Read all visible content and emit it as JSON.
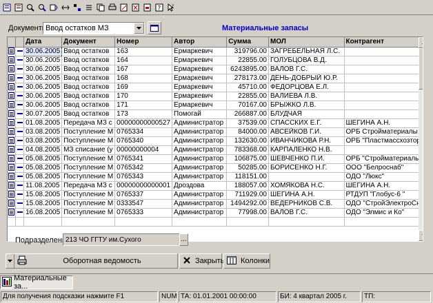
{
  "toolbar": {
    "icons": [
      "new-doc-icon",
      "list-icon",
      "find-icon",
      "find-next-icon",
      "sort-icon",
      "filter-icon",
      "split-icon",
      "columns-icon",
      "copy-icon",
      "print-icon",
      "edit-icon",
      "delete-icon",
      "export-icon",
      "help-icon",
      "pointer-help-icon"
    ]
  },
  "filter": {
    "documents_label": "Документы",
    "documents_value": "Ввод остатков МЗ"
  },
  "title": "Материальные запасы",
  "table": {
    "columns": [
      "",
      "",
      "Дата",
      "Документ",
      "Номер",
      "Автор",
      "Сумма",
      "МОЛ",
      "Контрагент"
    ],
    "rows": [
      {
        "date": "30.06.2005",
        "doc": "Ввод остатков",
        "num": "163",
        "author": "Ермаркевич",
        "sum": "319796.00",
        "mol": "ЗАГРЕБЕЛЬНАЯ Л.С.",
        "agent": ""
      },
      {
        "date": "30.06.2005",
        "doc": "Ввод остатков",
        "num": "164",
        "author": "Ермаркевич",
        "sum": "22855.00",
        "mol": "ГОЛУБЦОВА В.Д.",
        "agent": ""
      },
      {
        "date": "30.06.2005",
        "doc": "Ввод остатков",
        "num": "167",
        "author": "Ермаркевич",
        "sum": "6243895.00",
        "mol": "ВАЛОВ Г.С.",
        "agent": ""
      },
      {
        "date": "30.06.2005",
        "doc": "Ввод остатков",
        "num": "168",
        "author": "Ермаркевич",
        "sum": "278173.00",
        "mol": "ДЕНЬ-ДОБРЫЙ Ю.Р.",
        "agent": ""
      },
      {
        "date": "30.06.2005",
        "doc": "Ввод остатков",
        "num": "169",
        "author": "Ермаркевич",
        "sum": "45710.00",
        "mol": "ФЕДОРЦОВА Е.Л.",
        "agent": ""
      },
      {
        "date": "30.06.2005",
        "doc": "Ввод остатков",
        "num": "170",
        "author": "Ермаркевич",
        "sum": "22855.00",
        "mol": "ВАЛИЕВА Л.В.",
        "agent": ""
      },
      {
        "date": "30.06.2005",
        "doc": "Ввод остатков",
        "num": "171",
        "author": "Ермаркевич",
        "sum": "70167.00",
        "mol": "БРЫЖКО Л.В.",
        "agent": ""
      },
      {
        "date": "30.07.2005",
        "doc": "Ввод остатков",
        "num": "173",
        "author": "Помогай",
        "sum": "266887.00",
        "mol": "БЛУДЧАЯ",
        "agent": ""
      },
      {
        "date": "01.08.2005",
        "doc": "Передача МЗ с",
        "num": "00000000000527",
        "author": "Администратор",
        "sum": "37539.00",
        "mol": "СПАССКИХ Е.Г.",
        "agent": "ШЕГИНА А.Н."
      },
      {
        "date": "03.08.2005",
        "doc": "Поступление М",
        "num": "0765334",
        "author": "Администратор",
        "sum": "84000.00",
        "mol": "АВСЕЙКОВ Г.И.",
        "agent": "ОРБ Стройматериалы"
      },
      {
        "date": "03.08.2005",
        "doc": "Поступление М",
        "num": "0765340",
        "author": "Администратор",
        "sum": "132630.00",
        "mol": "ИВАНЧИКОВА Р.Н.",
        "agent": "ОРБ \"Пластмассхозтор"
      },
      {
        "date": "04.08.2005",
        "doc": "МЗ списание (у",
        "num": "00000000004",
        "author": "Администратор",
        "sum": "783368.00",
        "mol": "КАРПАЛЕНКО Н.В.",
        "agent": ""
      },
      {
        "date": "05.08.2005",
        "doc": "Поступление М",
        "num": "0765341",
        "author": "Администратор",
        "sum": "106875.00",
        "mol": "ШЕВЧЕНКО П.И.",
        "agent": "ОРБ \"Стройматериалы"
      },
      {
        "date": "05.08.2005",
        "doc": "Поступление М",
        "num": "0765342",
        "author": "Администратор",
        "sum": "50285.00",
        "mol": "БОРИСЕНКО Н.Г.",
        "agent": "ООО \"Белроснаб\""
      },
      {
        "date": "05.08.2005",
        "doc": "Поступление М",
        "num": "0765343",
        "author": "Администратор",
        "sum": "118151.00",
        "mol": "",
        "agent": "ОДО \"Люкс\""
      },
      {
        "date": "11.08.2005",
        "doc": "Передача МЗ с",
        "num": "00000000000001",
        "author": "Дроздова",
        "sum": "188057.00",
        "mol": "ХОМЯКОВА Н.С.",
        "agent": "ШЕГИНА А.Н."
      },
      {
        "date": "15.08.2005",
        "doc": "Поступление М",
        "num": "0765337",
        "author": "Администратор",
        "sum": "711929.00",
        "mol": "ШЕГИНА А.Н.",
        "agent": "РТДУП \"Глобус-6 \""
      },
      {
        "date": "15.08.2005",
        "doc": "Поступление М",
        "num": "0333547",
        "author": "Администратор",
        "sum": "1494292.00",
        "mol": "ВЕДЕРНИКОВ С.В.",
        "agent": "ОДО \"СтройЭлектроСн"
      },
      {
        "date": "16.08.2005",
        "doc": "Поступление М",
        "num": "0765333",
        "author": "Администратор",
        "sum": "77998.00",
        "mol": "ВАЛОВ Г.С.",
        "agent": "ОДО \"Элмис и Ко\""
      },
      {
        "date": "",
        "doc": "",
        "num": "",
        "author": "",
        "sum": "",
        "mol": "",
        "agent": ""
      }
    ]
  },
  "department": {
    "label": "Подразделение",
    "value": "213 ЧО ГГТУ им.Сухого",
    "picker": "..."
  },
  "buttons": {
    "report": "Оборотная ведомость",
    "close": "Закрыть",
    "columns": "Колонки"
  },
  "taskbar": {
    "window": "Материальные за..."
  },
  "status": {
    "hint": "Для получения подсказки нажмите F1",
    "num": "NUM",
    "ta": "ТА: 01.01.2001  00:00:00",
    "bi": "БИ: 4 квартал 2005 г.",
    "tp": "ТП:"
  }
}
